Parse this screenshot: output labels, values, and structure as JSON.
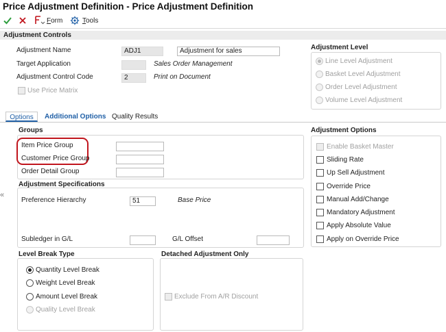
{
  "window": {
    "title": "Price Adjustment Definition - Price Adjustment Definition"
  },
  "toolbar": {
    "ok_icon": "checkmark-icon",
    "cancel_icon": "close-x-icon",
    "form_label": "Form",
    "tools_label": "Tools",
    "form_icon": "form-menu-icon",
    "tools_icon": "gear-icon"
  },
  "adjustment_controls": {
    "title": "Adjustment Controls",
    "adjustment_name_label": "Adjustment Name",
    "adjustment_name_value": "ADJ1",
    "adjustment_description": "Adjustment for sales",
    "target_application_label": "Target Application",
    "target_application_value": "",
    "target_application_desc": "Sales Order Management",
    "control_code_label": "Adjustment Control Code",
    "control_code_value": "2",
    "control_code_desc": "Print on Document",
    "use_price_matrix_label": "Use Price Matrix"
  },
  "adjustment_level": {
    "title": "Adjustment Level",
    "options": [
      {
        "label": "Line Level Adjustment",
        "selected": true
      },
      {
        "label": "Basket Level Adjustment",
        "selected": false
      },
      {
        "label": "Order Level Adjustment",
        "selected": false
      },
      {
        "label": "Volume Level Adjustment",
        "selected": false
      }
    ]
  },
  "tabs": [
    {
      "label": "Options",
      "active": true
    },
    {
      "label": "Additional Options",
      "active": false
    },
    {
      "label": "Quality Results",
      "active": false
    }
  ],
  "groups": {
    "title": "Groups",
    "item_price_group_label": "Item Price Group",
    "item_price_group_value": "",
    "customer_price_group_label": "Customer Price Group",
    "customer_price_group_value": "",
    "order_detail_group_label": "Order Detail Group",
    "order_detail_group_value": "",
    "highlight_color": "#c0141c"
  },
  "adjustment_specifications": {
    "title": "Adjustment Specifications",
    "preference_hierarchy_label": "Preference Hierarchy",
    "preference_hierarchy_value": "51",
    "preference_hierarchy_desc": "Base Price",
    "subledger_label": "Subledger in G/L",
    "subledger_value": "",
    "gl_offset_label": "G/L Offset",
    "gl_offset_value": ""
  },
  "level_break_type": {
    "title": "Level Break Type",
    "options": [
      {
        "label": "Quantity Level Break",
        "selected": true,
        "disabled": false
      },
      {
        "label": "Weight Level Break",
        "selected": false,
        "disabled": false
      },
      {
        "label": "Amount Level Break",
        "selected": false,
        "disabled": false
      },
      {
        "label": "Quality Level Break",
        "selected": false,
        "disabled": true
      }
    ]
  },
  "detached_adjustment": {
    "title": "Detached Adjustment Only",
    "exclude_label": "Exclude From A/R Discount"
  },
  "adjustment_options": {
    "title": "Adjustment Options",
    "items": [
      {
        "label": "Enable Basket Master",
        "checked": false,
        "disabled": true
      },
      {
        "label": "Sliding Rate",
        "checked": false,
        "disabled": false
      },
      {
        "label": "Up Sell Adjustment",
        "checked": false,
        "disabled": false
      },
      {
        "label": "Override Price",
        "checked": false,
        "disabled": false
      },
      {
        "label": "Manual Add/Change",
        "checked": false,
        "disabled": false
      },
      {
        "label": "Mandatory Adjustment",
        "checked": false,
        "disabled": false
      },
      {
        "label": "Apply Absolute Value",
        "checked": false,
        "disabled": false
      },
      {
        "label": "Apply on Override Price",
        "checked": false,
        "disabled": false
      }
    ]
  },
  "side_collapse_glyph": "«",
  "colors": {
    "accent": "#1f5fa6",
    "ok_green": "#2e9e3e",
    "cancel_red": "#c0141c"
  }
}
